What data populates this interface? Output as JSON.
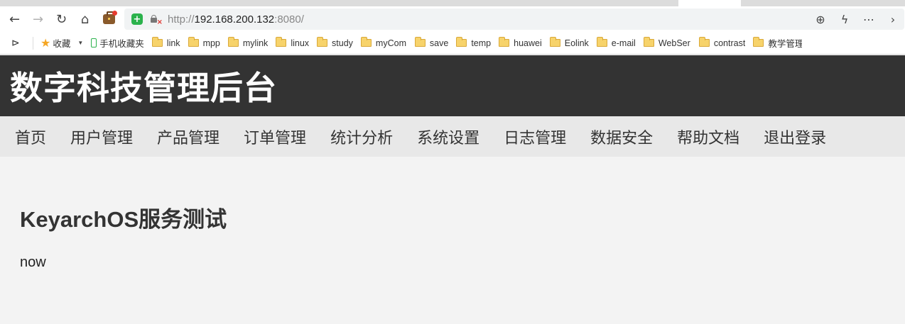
{
  "browser": {
    "url_prefix": "http://",
    "url_host": "192.168.200.132",
    "url_suffix": ":8080/",
    "bookmarks": [
      {
        "label": "收藏",
        "icon": "star-icon"
      },
      {
        "label": "手机收藏夹",
        "icon": "phone-icon"
      },
      {
        "label": "link",
        "icon": "folder-icon"
      },
      {
        "label": "mpp",
        "icon": "folder-icon"
      },
      {
        "label": "mylink",
        "icon": "folder-icon"
      },
      {
        "label": "linux",
        "icon": "folder-icon"
      },
      {
        "label": "study",
        "icon": "folder-icon"
      },
      {
        "label": "myCom",
        "icon": "folder-icon"
      },
      {
        "label": "save",
        "icon": "folder-icon"
      },
      {
        "label": "temp",
        "icon": "folder-icon"
      },
      {
        "label": "huawei",
        "icon": "folder-icon"
      },
      {
        "label": "Eolink",
        "icon": "folder-icon"
      },
      {
        "label": "e-mail",
        "icon": "folder-icon"
      },
      {
        "label": "WebSer",
        "icon": "folder-icon"
      },
      {
        "label": "contrast",
        "icon": "folder-icon"
      },
      {
        "label": "教学管理",
        "icon": "folder-icon"
      }
    ]
  },
  "site": {
    "title": "数字科技管理后台",
    "nav": [
      "首页",
      "用户管理",
      "产品管理",
      "订单管理",
      "统计分析",
      "系统设置",
      "日志管理",
      "数据安全",
      "帮助文档",
      "退出登录"
    ],
    "heading": "KeyarchOS服务测试",
    "body_text": "now"
  },
  "colors": {
    "header_bg": "#333333",
    "nav_bg": "#e8e8e8",
    "page_bg": "#f3f3f3"
  }
}
